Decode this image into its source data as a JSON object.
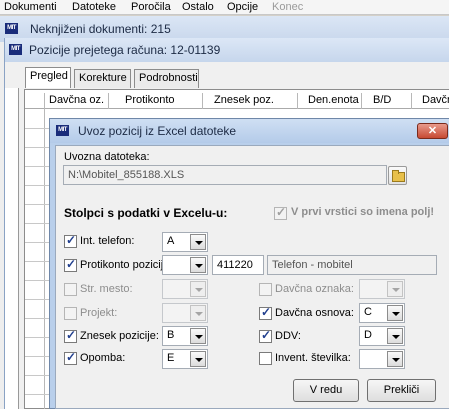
{
  "menubar": {
    "items": [
      "Dokumenti",
      "Datoteke",
      "Poročila",
      "Ostalo",
      "Opcije",
      "Konec"
    ]
  },
  "window_outer": {
    "title": "Neknjiženi dokumenti: 215"
  },
  "window_inner": {
    "title": "Pozicije prejetega računa: 12-01139",
    "tabs": [
      "Pregled",
      "Korekture",
      "Podrobnosti"
    ],
    "grid_columns": [
      "Davčna oz.",
      "Protikonto",
      "Znesek poz.",
      "Den.enota",
      "B/D",
      "Davčn"
    ]
  },
  "dialog": {
    "title": "Uvoz pozicij iz Excel datoteke",
    "file_label": "Uvozna datoteka:",
    "file_value": "N:\\Mobitel_855188.XLS",
    "section_label": "Stolpci s podatki v Excelu-u:",
    "first_row_label": "V prvi vrstici so imena polj!",
    "first_row_checked": true,
    "left_fields": [
      {
        "label": "Int. telefon:",
        "checked": true,
        "enabled": true,
        "value": "A"
      },
      {
        "label": "Protikonto pozicij:",
        "checked": true,
        "enabled": true,
        "value": ""
      },
      {
        "label": "Str. mesto:",
        "checked": false,
        "enabled": false,
        "value": ""
      },
      {
        "label": "Projekt:",
        "checked": false,
        "enabled": false,
        "value": ""
      },
      {
        "label": "Znesek pozicije:",
        "checked": true,
        "enabled": true,
        "value": "B"
      },
      {
        "label": "Opomba:",
        "checked": true,
        "enabled": true,
        "value": "E"
      }
    ],
    "protikonto_code": "411220",
    "protikonto_name": "Telefon - mobitel",
    "right_fields": [
      {
        "label": "Davčna oznaka:",
        "checked": false,
        "enabled": false,
        "value": ""
      },
      {
        "label": "Davčna osnova:",
        "checked": true,
        "enabled": true,
        "value": "C"
      },
      {
        "label": "DDV:",
        "checked": true,
        "enabled": true,
        "value": "D"
      },
      {
        "label": "Invent. številka:",
        "checked": false,
        "enabled": true,
        "value": ""
      }
    ],
    "ok_label": "V redu",
    "cancel_label": "Prekliči",
    "close_glyph": "✕"
  }
}
